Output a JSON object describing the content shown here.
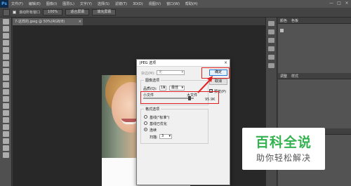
{
  "app": {
    "logo": "Ps"
  },
  "menubar": {
    "items": [
      "文件(F)",
      "编辑(E)",
      "图像(I)",
      "图层(L)",
      "文字(Y)",
      "选择(S)",
      "滤镜(T)",
      "3D(D)",
      "视图(V)",
      "窗口(W)",
      "帮助(H)"
    ],
    "controls": [
      "—",
      "□",
      "×"
    ]
  },
  "optionsbar": {
    "scroll_all_label": "滚动所有窗口",
    "btn_100": "100%",
    "btn_fit": "适合屏幕",
    "btn_fill": "填充屏幕"
  },
  "document": {
    "tab_label": "7-这样的.jpeg @ 50%(RGB/8)",
    "close": "×"
  },
  "panels": {
    "head1": [
      "颜色",
      "色板"
    ],
    "head2": [
      "调整",
      "样式"
    ],
    "head3": [
      "图层",
      "通道",
      "路径"
    ],
    "layer_name": "背景"
  },
  "dialog": {
    "title": "JPEG 选项",
    "close": "×",
    "matte_label": "杂边(M):",
    "matte_value": "无",
    "image_options_label": "图像选项",
    "quality_label": "品质(Q):",
    "quality_value": "11",
    "quality_level": "最佳",
    "small_file_label": "小文件",
    "large_file_label": "大文件",
    "file_size": "95.9K",
    "format_options_label": "格式选项",
    "baseline_standard": "基线(\"标准\")",
    "baseline_optimized": "基线已优化",
    "progressive": "连续",
    "scans_label": "扫描:",
    "scans_value": "3",
    "ok_label": "确定",
    "cancel_label": "取消",
    "preview_label": "预览(P)",
    "quality_slider_fraction": 0.92
  },
  "watermark": {
    "main": "百科全说",
    "sub": "助你轻松解决",
    "color": "#34b24f"
  }
}
